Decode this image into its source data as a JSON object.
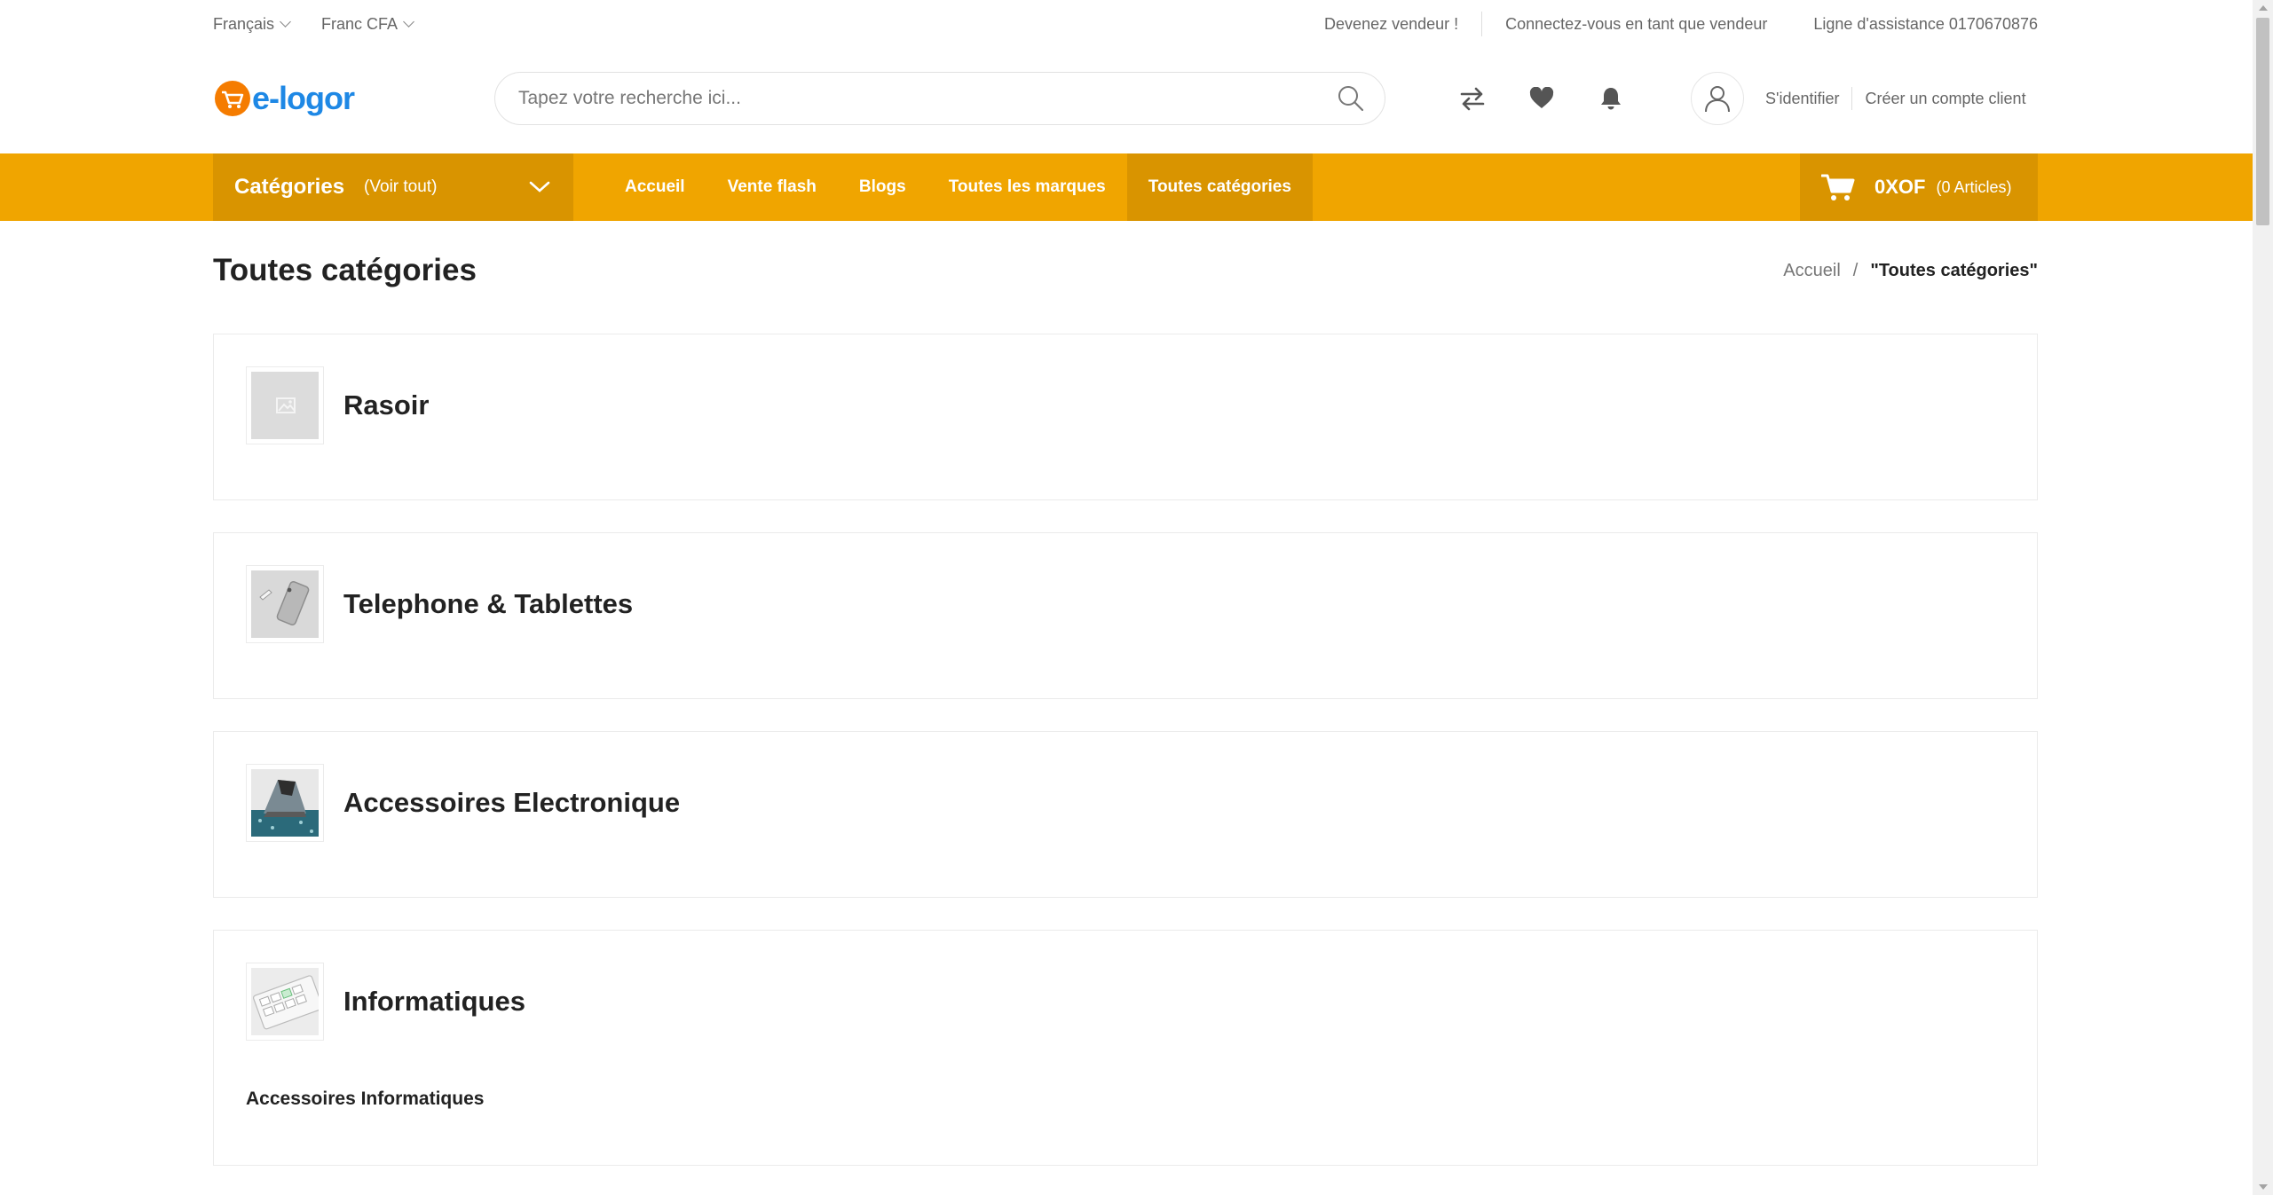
{
  "topbar": {
    "language": "Français",
    "currency": "Franc CFA",
    "become_seller": "Devenez vendeur !",
    "seller_login": "Connectez-vous en tant que vendeur",
    "helpline": "Ligne d'assistance 0170670876"
  },
  "header": {
    "logo": "e-logor",
    "search_placeholder": "Tapez votre recherche ici...",
    "login": "S'identifier",
    "register": "Créer un compte client"
  },
  "nav": {
    "categories_label": "Catégories",
    "see_all": "(Voir tout)",
    "items": [
      "Accueil",
      "Vente flash",
      "Blogs",
      "Toutes les marques",
      "Toutes catégories"
    ],
    "cart_amount": "0XOF",
    "cart_count": "(0 Articles)"
  },
  "page": {
    "title": "Toutes catégories",
    "breadcrumb_home": "Accueil",
    "breadcrumb_current": "\"Toutes catégories\""
  },
  "categories": [
    {
      "name": "Rasoir",
      "icon": "placeholder-image-icon"
    },
    {
      "name": "Telephone & Tablettes",
      "icon": "phone-thumbnail"
    },
    {
      "name": "Accessoires Electronique",
      "icon": "iron-thumbnail"
    },
    {
      "name": "Informatiques",
      "icon": "keyboard-thumbnail",
      "subcategories": [
        "Accessoires Informatiques"
      ]
    }
  ],
  "colors": {
    "accent": "#f0a500",
    "accent_dark": "#d99400",
    "logo_blue": "#1e88e5",
    "logo_orange": "#f57c00"
  }
}
